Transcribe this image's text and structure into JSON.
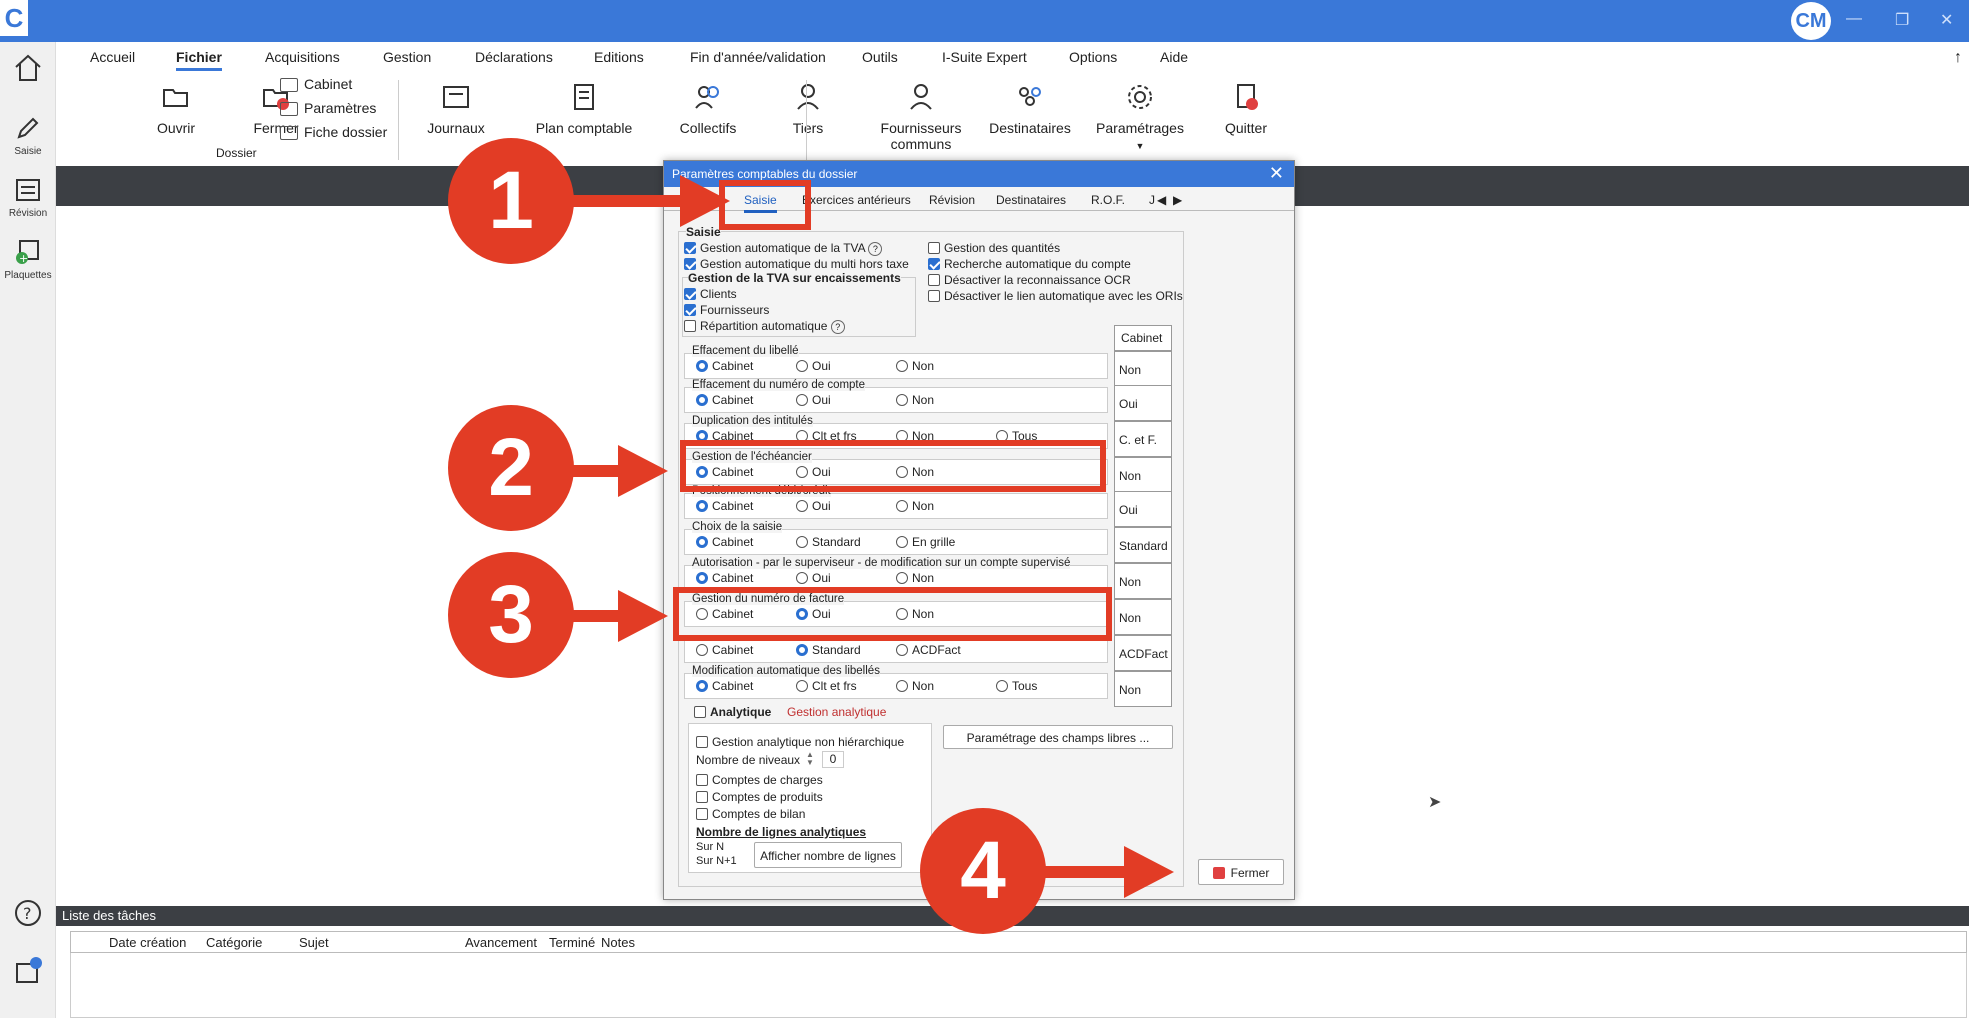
{
  "app": {
    "logo": "C",
    "avatar": "CM"
  },
  "left_nav": [
    {
      "label": ""
    },
    {
      "label": "Saisie"
    },
    {
      "label": "Révision"
    },
    {
      "label": "Plaquettes"
    }
  ],
  "menu": [
    "Accueil",
    "Fichier",
    "Acquisitions",
    "Gestion",
    "Déclarations",
    "Editions",
    "Fin d'année/validation",
    "Outils",
    "I-Suite Expert",
    "Options",
    "Aide"
  ],
  "ribbon": {
    "ouvrir": "Ouvrir",
    "fermer": "Fermer",
    "cabinet": "Cabinet",
    "parametres": "Paramètres",
    "fiche_dossier": "Fiche dossier",
    "dossier_group": "Dossier",
    "journaux": "Journaux",
    "plan_comptable": "Plan comptable",
    "collectifs": "Collectifs",
    "tiers": "Tiers",
    "fournisseurs_communs_1": "Fournisseurs",
    "fournisseurs_communs_2": "communs",
    "destinataires": "Destinataires",
    "parametrages": "Paramétrages",
    "quitter": "Quitter"
  },
  "dialog": {
    "title": "Paramètres comptables du dossier",
    "tabs": [
      "...éral",
      "Saisie",
      "Exercices antérieurs",
      "Révision",
      "Destinataires",
      "R.O.F.",
      "J"
    ],
    "saisie_label": "Saisie",
    "checks_left": [
      {
        "label": "Gestion automatique de la TVA",
        "checked": true
      },
      {
        "label": "Gestion automatique du multi hors taxe",
        "checked": true
      }
    ],
    "checks_right": [
      {
        "label": "Gestion des quantités",
        "checked": false
      },
      {
        "label": "Recherche automatique du compte",
        "checked": true
      },
      {
        "label": "Désactiver la reconnaissance OCR",
        "checked": false
      },
      {
        "label": "Désactiver le lien automatique avec les ORIs",
        "checked": false
      }
    ],
    "tva_group": {
      "title": "Gestion de la TVA sur encaissements",
      "items": [
        {
          "label": "Clients",
          "checked": true
        },
        {
          "label": "Fournisseurs",
          "checked": true
        },
        {
          "label": "Répartition automatique",
          "checked": false
        }
      ]
    },
    "cabinet_header": "Cabinet",
    "rows": [
      {
        "title": "Effacement du libellé",
        "options": [
          "Cabinet",
          "Oui",
          "Non"
        ],
        "selected": 0,
        "cabinet": "Non"
      },
      {
        "title": "Effacement du numéro de compte",
        "options": [
          "Cabinet",
          "Oui",
          "Non"
        ],
        "selected": 0,
        "cabinet": "Oui"
      },
      {
        "title": "Duplication des intitulés",
        "options": [
          "Cabinet",
          "Clt et frs",
          "Non",
          "Tous"
        ],
        "selected": 0,
        "cabinet": "C. et F."
      },
      {
        "title": "Gestion de l'échéancier",
        "options": [
          "Cabinet",
          "Oui",
          "Non"
        ],
        "selected": 0,
        "cabinet": "Non"
      },
      {
        "title": "Positionnement débit/crédit",
        "options": [
          "Cabinet",
          "Oui",
          "Non"
        ],
        "selected": 0,
        "cabinet": "Oui"
      },
      {
        "title": "Choix de la saisie",
        "options": [
          "Cabinet",
          "Standard",
          "En grille"
        ],
        "selected": 0,
        "cabinet": "Standard"
      },
      {
        "title": "Autorisation - par le superviseur - de modification sur un compte supervisé",
        "options": [
          "Cabinet",
          "Oui",
          "Non"
        ],
        "selected": 0,
        "cabinet": "Non"
      },
      {
        "title": "Gestion du numéro de facture",
        "options": [
          "Cabinet",
          "Oui",
          "Non"
        ],
        "selected": 1,
        "cabinet": "Non"
      },
      {
        "title": "",
        "options": [
          "Cabinet",
          "Standard",
          "ACDFact"
        ],
        "selected": 1,
        "cabinet": "ACDFact"
      },
      {
        "title": "Modification automatique des libellés",
        "options": [
          "Cabinet",
          "Clt et frs",
          "Non",
          "Tous"
        ],
        "selected": 0,
        "cabinet": "Non"
      }
    ],
    "analytique": {
      "label": "Analytique",
      "link": "Gestion analytique",
      "non_hier": "Gestion analytique non hiérarchique",
      "niveaux_label": "Nombre de niveaux",
      "niveaux_value": "0",
      "comptes": [
        "Comptes de charges",
        "Comptes de produits",
        "Comptes de bilan"
      ],
      "lignes_title": "Nombre de lignes analytiques",
      "sur_n": "Sur N",
      "sur_n1": "Sur N+1",
      "afficher": "Afficher nombre de lignes"
    },
    "champs_libres": "Paramétrage des champs libres ...",
    "fermer": "Fermer"
  },
  "tasks": {
    "title": "Liste des tâches",
    "columns": [
      "Date création",
      "Catégorie",
      "Sujet",
      "Avancement",
      "Terminé",
      "Notes"
    ]
  },
  "callouts": [
    "1",
    "2",
    "3",
    "4"
  ],
  "colors": {
    "accent": "#3a78d8",
    "callout": "#e23c25",
    "dark_band": "#3c3f44"
  }
}
